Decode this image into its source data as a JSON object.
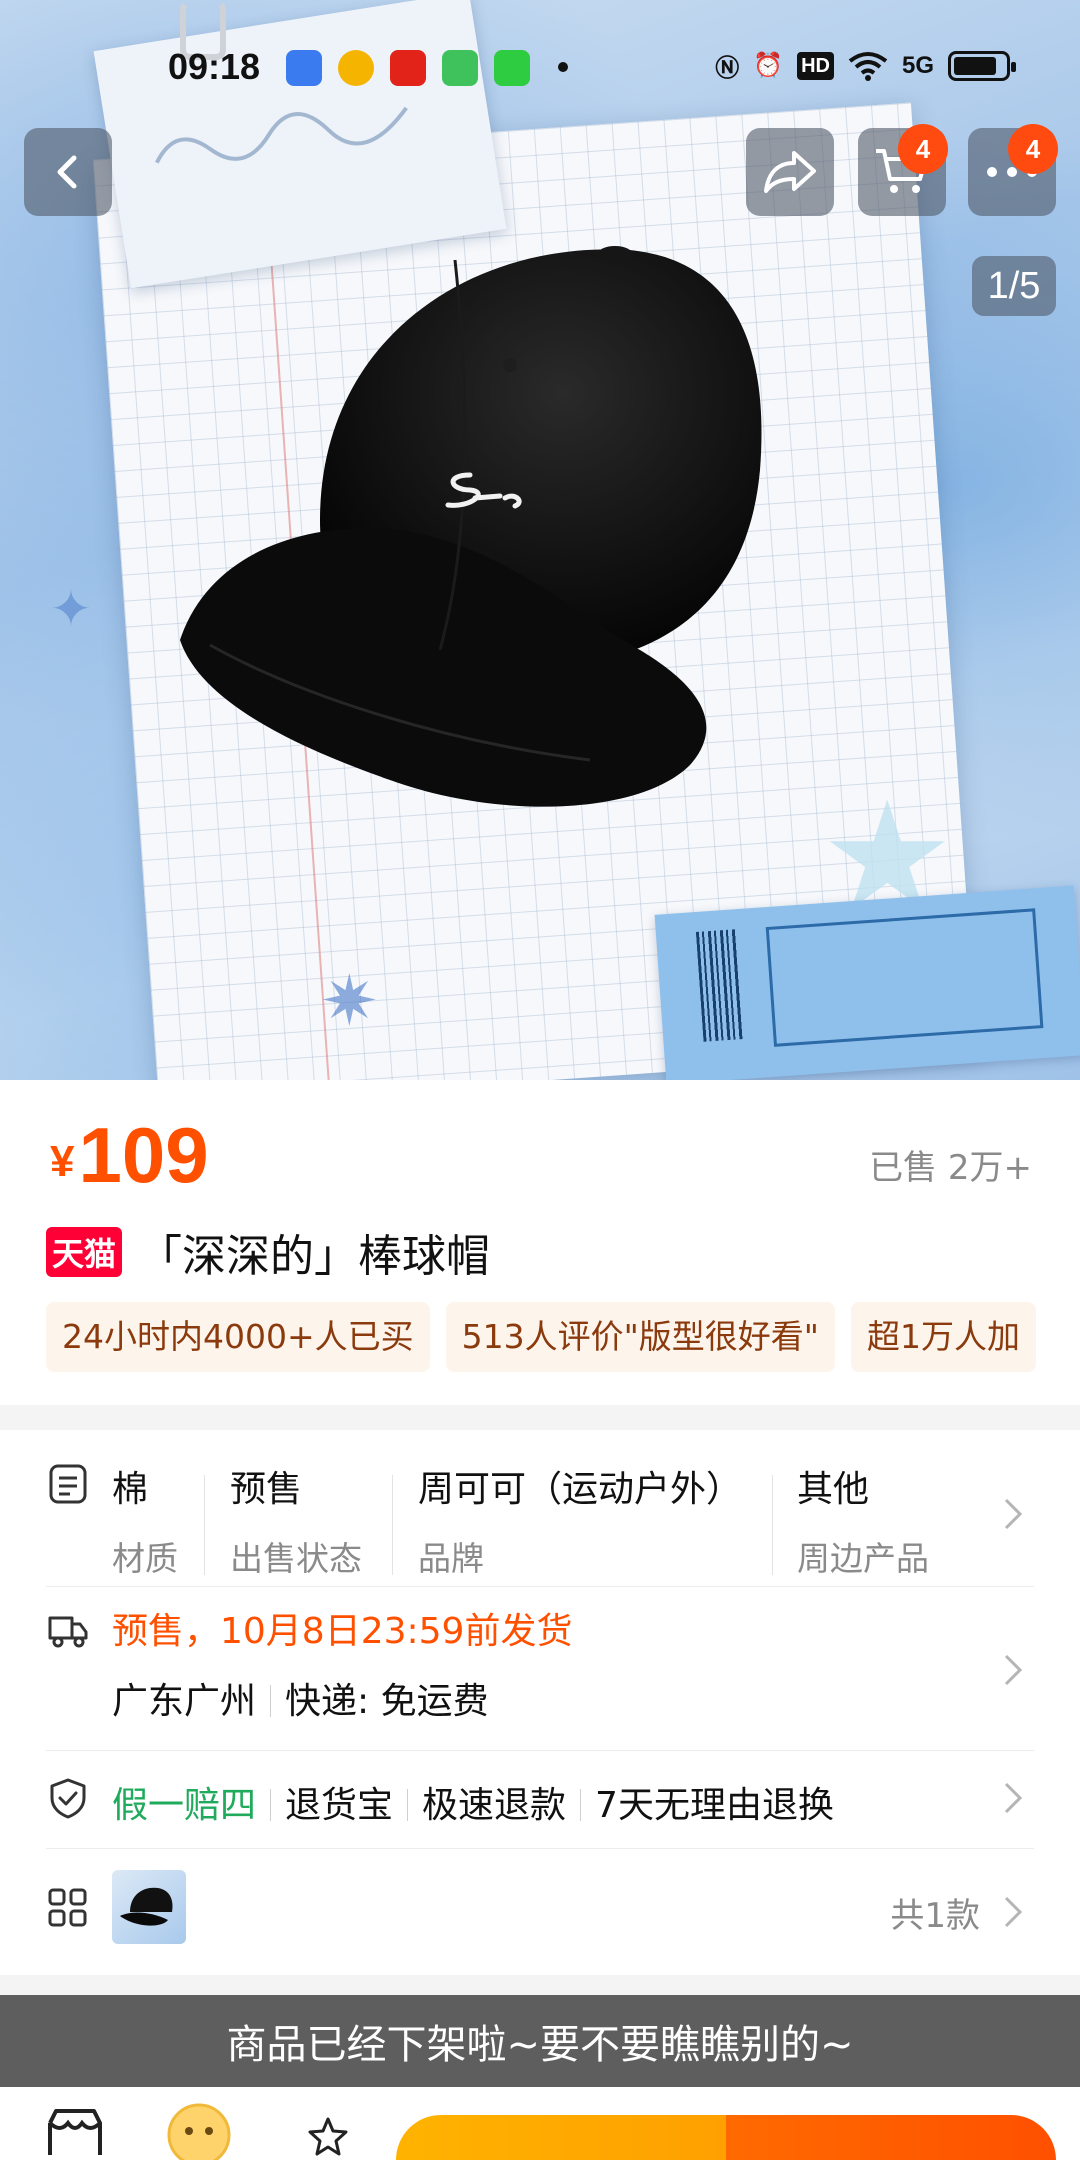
{
  "status_bar": {
    "time": "09:18",
    "network": "5G",
    "hd": "HD",
    "app_icons": [
      "map-app-icon",
      "weibo-icon",
      "pinduoduo-icon",
      "messages-icon",
      "iqiyi-icon"
    ]
  },
  "nav": {
    "cart_badge": "4",
    "more_badge": "4",
    "image_counter": "1/5"
  },
  "product": {
    "currency": "¥",
    "price": "109",
    "sold": "已售 2万+",
    "store_badge": "天猫",
    "title": "「深深的」棒球帽",
    "tags": [
      "24小时内4000+人已买",
      "513人评价\"版型很好看\"",
      "超1万人加"
    ]
  },
  "attributes": [
    {
      "value": "棉",
      "key": "材质"
    },
    {
      "value": "预售",
      "key": "出售状态"
    },
    {
      "value": "周可可（运动户外）",
      "key": "品牌"
    },
    {
      "value": "其他",
      "key": "周边产品"
    }
  ],
  "shipping": {
    "presale_notice": "预售，10月8日23:59前发货",
    "origin": "广东广州",
    "delivery": "快递: 免运费"
  },
  "guarantees": {
    "highlight": "假一赔四",
    "items": [
      "退货宝",
      "极速退款",
      "7天无理由退换"
    ]
  },
  "sku": {
    "count": "共1款"
  },
  "banner": {
    "text": "商品已经下架啦~要不要瞧瞧别的~"
  },
  "colors": {
    "price_orange": "#ff5000",
    "tmall_red": "#ff0036",
    "guarantee_green": "#1faa5c",
    "badge_orange": "#ff4a10"
  }
}
